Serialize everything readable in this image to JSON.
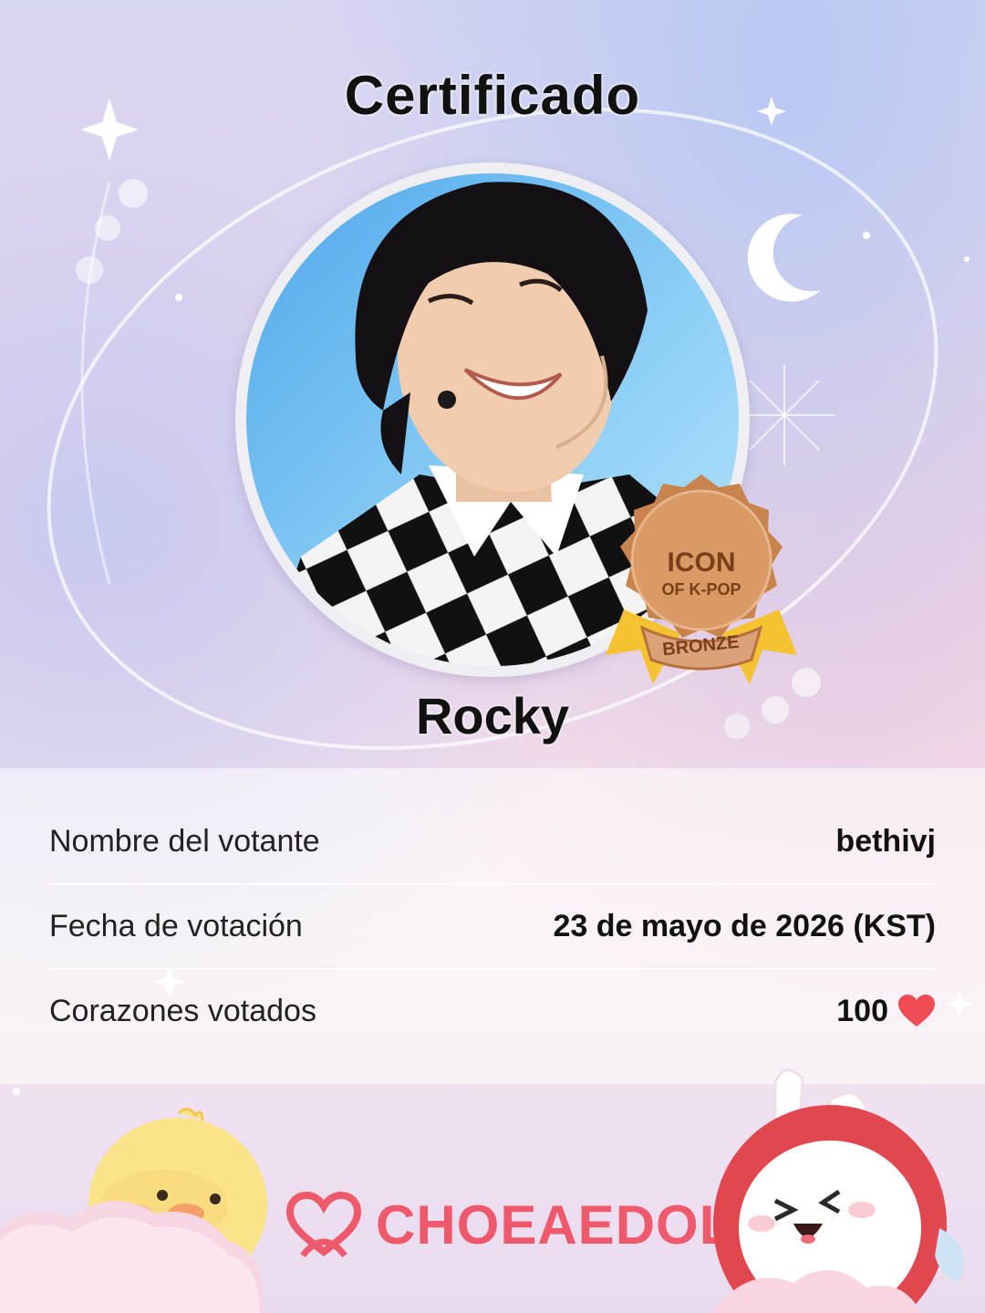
{
  "certificate": {
    "title": "Certificado",
    "idol_name": "Rocky"
  },
  "badge": {
    "line1": "ICON",
    "line2": "OF K-POP",
    "tier": "BRONZE"
  },
  "details": {
    "voter_label": "Nombre del votante",
    "voter_value": "bethivj",
    "date_label": "Fecha de votación",
    "date_value": "23 de mayo de 2026 (KST)",
    "hearts_label": "Corazones votados",
    "hearts_value": "100"
  },
  "brand": {
    "name": "CHOEAEDOL"
  },
  "colors": {
    "heart": "#ef4b55",
    "brand": "#ee5a6c",
    "bronze": "#cf8c55"
  },
  "icons": [
    "heart-icon",
    "choeaedol-logo-icon",
    "sparkle-icon",
    "moon-icon"
  ]
}
